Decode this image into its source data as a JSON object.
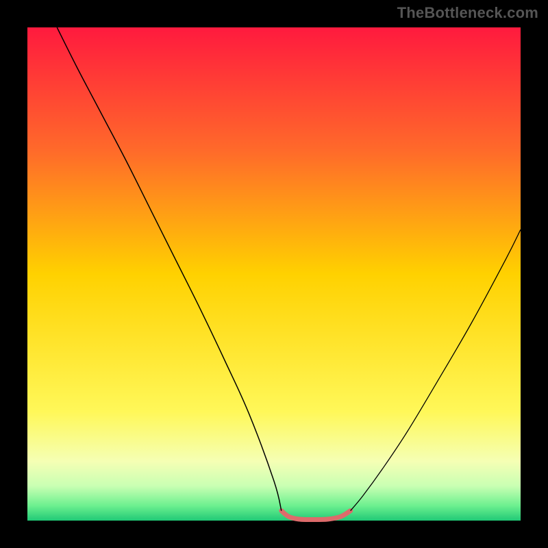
{
  "watermark": {
    "text": "TheBottleneck.com"
  },
  "chart_data": {
    "type": "line",
    "title": "",
    "xlabel": "",
    "ylabel": "",
    "xlim": [
      0,
      100
    ],
    "ylim": [
      0,
      100
    ],
    "grid": false,
    "legend": false,
    "background_gradient": {
      "stops": [
        {
          "pos": 0.0,
          "color": "#ff1a3e"
        },
        {
          "pos": 0.25,
          "color": "#ff6a2a"
        },
        {
          "pos": 0.5,
          "color": "#ffd100"
        },
        {
          "pos": 0.78,
          "color": "#fff859"
        },
        {
          "pos": 0.88,
          "color": "#f5ffb4"
        },
        {
          "pos": 0.93,
          "color": "#c9ffb3"
        },
        {
          "pos": 0.97,
          "color": "#6cf08f"
        },
        {
          "pos": 1.0,
          "color": "#20c976"
        }
      ]
    },
    "series": [
      {
        "name": "left-branch",
        "color": "#000000",
        "stroke_width": 1.5,
        "x": [
          6,
          10,
          15,
          20,
          25,
          30,
          35,
          40,
          45,
          50,
          51.5
        ],
        "y": [
          100,
          92,
          82.5,
          73,
          63,
          53,
          43,
          32.5,
          21.5,
          8,
          2
        ]
      },
      {
        "name": "right-branch",
        "color": "#000000",
        "stroke_width": 1.3,
        "x": [
          65.5,
          68,
          72,
          77,
          83,
          90,
          97,
          100
        ],
        "y": [
          2,
          5,
          10.5,
          18,
          28,
          40,
          53,
          59
        ]
      },
      {
        "name": "valley-highlight",
        "color": "#dd6b6b",
        "stroke_width": 7,
        "linecap": "round",
        "x": [
          51.5,
          53,
          55,
          58,
          61,
          63.5,
          65.5
        ],
        "y": [
          2,
          0.8,
          0.3,
          0.2,
          0.3,
          0.8,
          2
        ]
      }
    ],
    "annotations": []
  }
}
